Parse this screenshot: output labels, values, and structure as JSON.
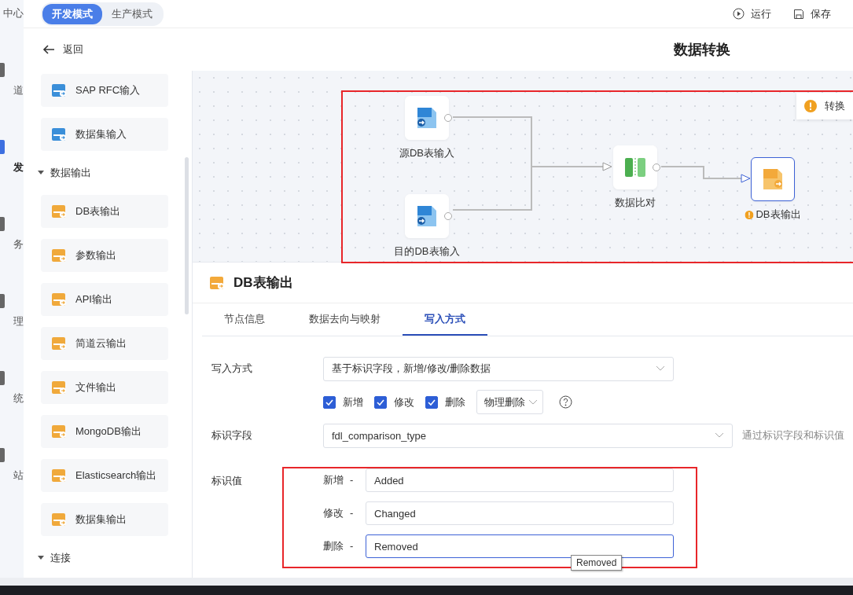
{
  "nav_rail": [
    {
      "label": "中心",
      "selected": false
    },
    {
      "label": "道",
      "selected": false
    },
    {
      "label": "发",
      "selected": true
    },
    {
      "label": "务",
      "selected": false
    },
    {
      "label": "理",
      "selected": false
    },
    {
      "label": "统",
      "selected": false
    },
    {
      "label": "站",
      "selected": false
    }
  ],
  "mode_toggle": [
    {
      "label": "开发模式",
      "selected": true
    },
    {
      "label": "生产模式",
      "selected": false
    }
  ],
  "toolbar": [
    {
      "kind": "run",
      "label": "运行"
    },
    {
      "kind": "save",
      "label": "保存"
    }
  ],
  "back": "返回",
  "title": "数据转换",
  "palette": [
    {
      "kind": "item",
      "label": "SAP RFC输入",
      "color": "#3b8fd9"
    },
    {
      "kind": "item",
      "label": "数据集输入",
      "color": "#3b8fd9"
    },
    {
      "kind": "group",
      "label": "数据输出",
      "expanded": true
    },
    {
      "kind": "item",
      "label": "DB表输出",
      "color": "#f0a93b"
    },
    {
      "kind": "item",
      "label": "参数输出",
      "color": "#f0a93b"
    },
    {
      "kind": "item",
      "label": "API输出",
      "color": "#f0a93b"
    },
    {
      "kind": "item",
      "label": "简道云输出",
      "color": "#f0a93b"
    },
    {
      "kind": "item",
      "label": "文件输出",
      "color": "#f0a93b"
    },
    {
      "kind": "item",
      "label": "MongoDB输出",
      "color": "#f0a93b"
    },
    {
      "kind": "item",
      "label": "Elasticsearch输出",
      "color": "#f0a93b"
    },
    {
      "kind": "item",
      "label": "数据集输出",
      "color": "#f0a93b"
    },
    {
      "kind": "group",
      "label": "连接",
      "expanded": true
    }
  ],
  "canvas": {
    "nodes": [
      {
        "kind": "db-input",
        "label": "源DB表输入",
        "selected": false,
        "warning": false
      },
      {
        "kind": "db-input",
        "label": "目的DB表输入",
        "selected": false,
        "warning": false
      },
      {
        "kind": "compare",
        "label": "数据比对",
        "selected": false,
        "warning": false
      },
      {
        "kind": "db-output",
        "label": "DB表输出",
        "selected": true,
        "warning": true
      }
    ],
    "toast": "转换"
  },
  "panel": {
    "title": "DB表输出",
    "tabs": [
      {
        "label": "节点信息",
        "selected": false
      },
      {
        "label": "数据去向与映射",
        "selected": false
      },
      {
        "label": "写入方式",
        "selected": true
      }
    ],
    "write_mode": {
      "label": "写入方式",
      "value": "基于标识字段，新增/修改/删除数据"
    },
    "operations": [
      {
        "label": "新增",
        "checked": true
      },
      {
        "label": "修改",
        "checked": true
      },
      {
        "label": "删除",
        "checked": true
      }
    ],
    "delete_mode": "物理删除",
    "id_field": {
      "label": "标识字段",
      "value": "fdl_comparison_type",
      "hint": "通过标识字段和标识值"
    },
    "id_values": {
      "label": "标识值",
      "rows": [
        {
          "label": "新增",
          "dash": "-",
          "value": "Added",
          "focused": false
        },
        {
          "label": "修改",
          "dash": "-",
          "value": "Changed",
          "focused": false
        },
        {
          "label": "删除",
          "dash": "-",
          "value": "Removed",
          "focused": true
        }
      ]
    }
  },
  "tooltip": "Removed"
}
